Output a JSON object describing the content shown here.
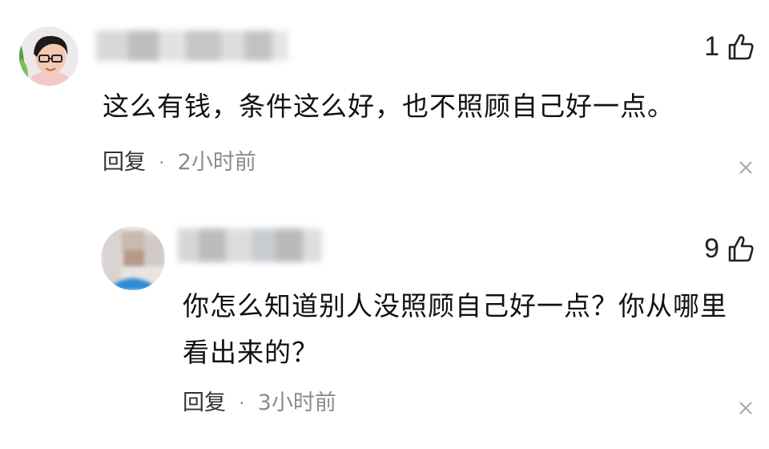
{
  "comments": [
    {
      "likes": "1",
      "text": "这么有钱，条件这么好，也不照顾自己好一点。",
      "reply_label": "回复",
      "separator": "·",
      "time": "2小时前"
    },
    {
      "likes": "9",
      "text": "你怎么知道别人没照顾自己好一点？你从哪里看出来的？",
      "reply_label": "回复",
      "separator": "·",
      "time": "3小时前"
    }
  ],
  "icons": {
    "like": "thumbs-up-icon",
    "close": "close-icon"
  },
  "colors": {
    "text": "#111111",
    "meta": "#8c8c8c",
    "icon": "#222222",
    "close": "#a8a8a8"
  }
}
